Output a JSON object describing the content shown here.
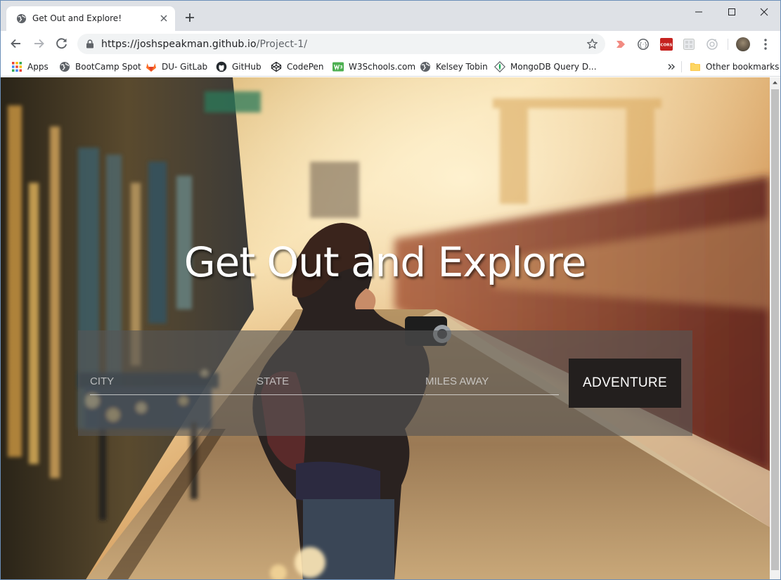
{
  "browser": {
    "tab_title": "Get Out and Explore!",
    "url_host": "https://joshspeakman.github.io",
    "url_path": "/Project-1/"
  },
  "bookmarks": {
    "items": [
      {
        "label": "Apps",
        "icon": "apps-grid-icon"
      },
      {
        "label": "BootCamp Spot",
        "icon": "globe-icon"
      },
      {
        "label": "DU- GitLab",
        "icon": "gitlab-icon"
      },
      {
        "label": "GitHub",
        "icon": "github-icon"
      },
      {
        "label": "CodePen",
        "icon": "codepen-icon"
      },
      {
        "label": "W3Schools.com",
        "icon": "w3schools-icon"
      },
      {
        "label": "Kelsey Tobin",
        "icon": "globe-icon"
      },
      {
        "label": "MongoDB Query D...",
        "icon": "mongodb-icon"
      }
    ],
    "other_label": "Other bookmarks"
  },
  "extensions": [
    {
      "name": "extension-icon",
      "color": "#f28b82"
    },
    {
      "name": "json-viewer-icon",
      "color": "#5f6368"
    },
    {
      "name": "cors-icon",
      "label": "CORS",
      "color": "#c5221f"
    },
    {
      "name": "extension-icon",
      "color": "#bdc1c6"
    },
    {
      "name": "extension-icon",
      "color": "#bdc1c6"
    }
  ],
  "hero": {
    "title": "Get Out and Explore"
  },
  "form": {
    "city_placeholder": "CITY",
    "state_placeholder": "STATE",
    "miles_placeholder": "MILES AWAY",
    "submit_label": "ADVENTURE"
  },
  "colors": {
    "button_bg": "#231f1e",
    "panel_bg": "rgba(85,85,85,0.62)",
    "tab_strip": "#dee1e6",
    "omnibox": "#f1f3f4"
  }
}
